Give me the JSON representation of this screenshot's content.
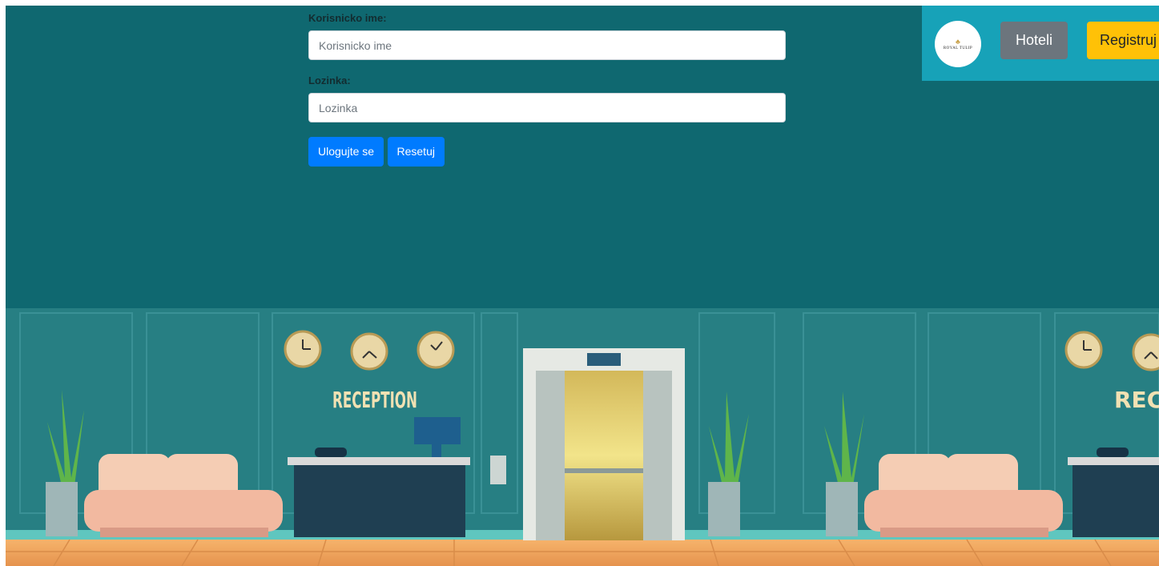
{
  "login": {
    "username_label": "Korisnicko ime:",
    "username_placeholder": "Korisnicko ime",
    "password_label": "Lozinka:",
    "password_placeholder": "Lozinka",
    "login_button": "Ulogujte se",
    "reset_button": "Resetuj"
  },
  "navbar": {
    "logo_text": "ROYAL TULIP",
    "hotels_button": "Hoteli",
    "register_button": "Registruj"
  },
  "background": {
    "sign_left": "RECEPTION",
    "sign_right": "RECEP"
  },
  "colors": {
    "page_bg": "#0f6870",
    "wall": "#277f83",
    "navbar": "#17a2b8",
    "primary": "#007bff",
    "secondary": "#6c757d",
    "warning": "#ffc107"
  }
}
